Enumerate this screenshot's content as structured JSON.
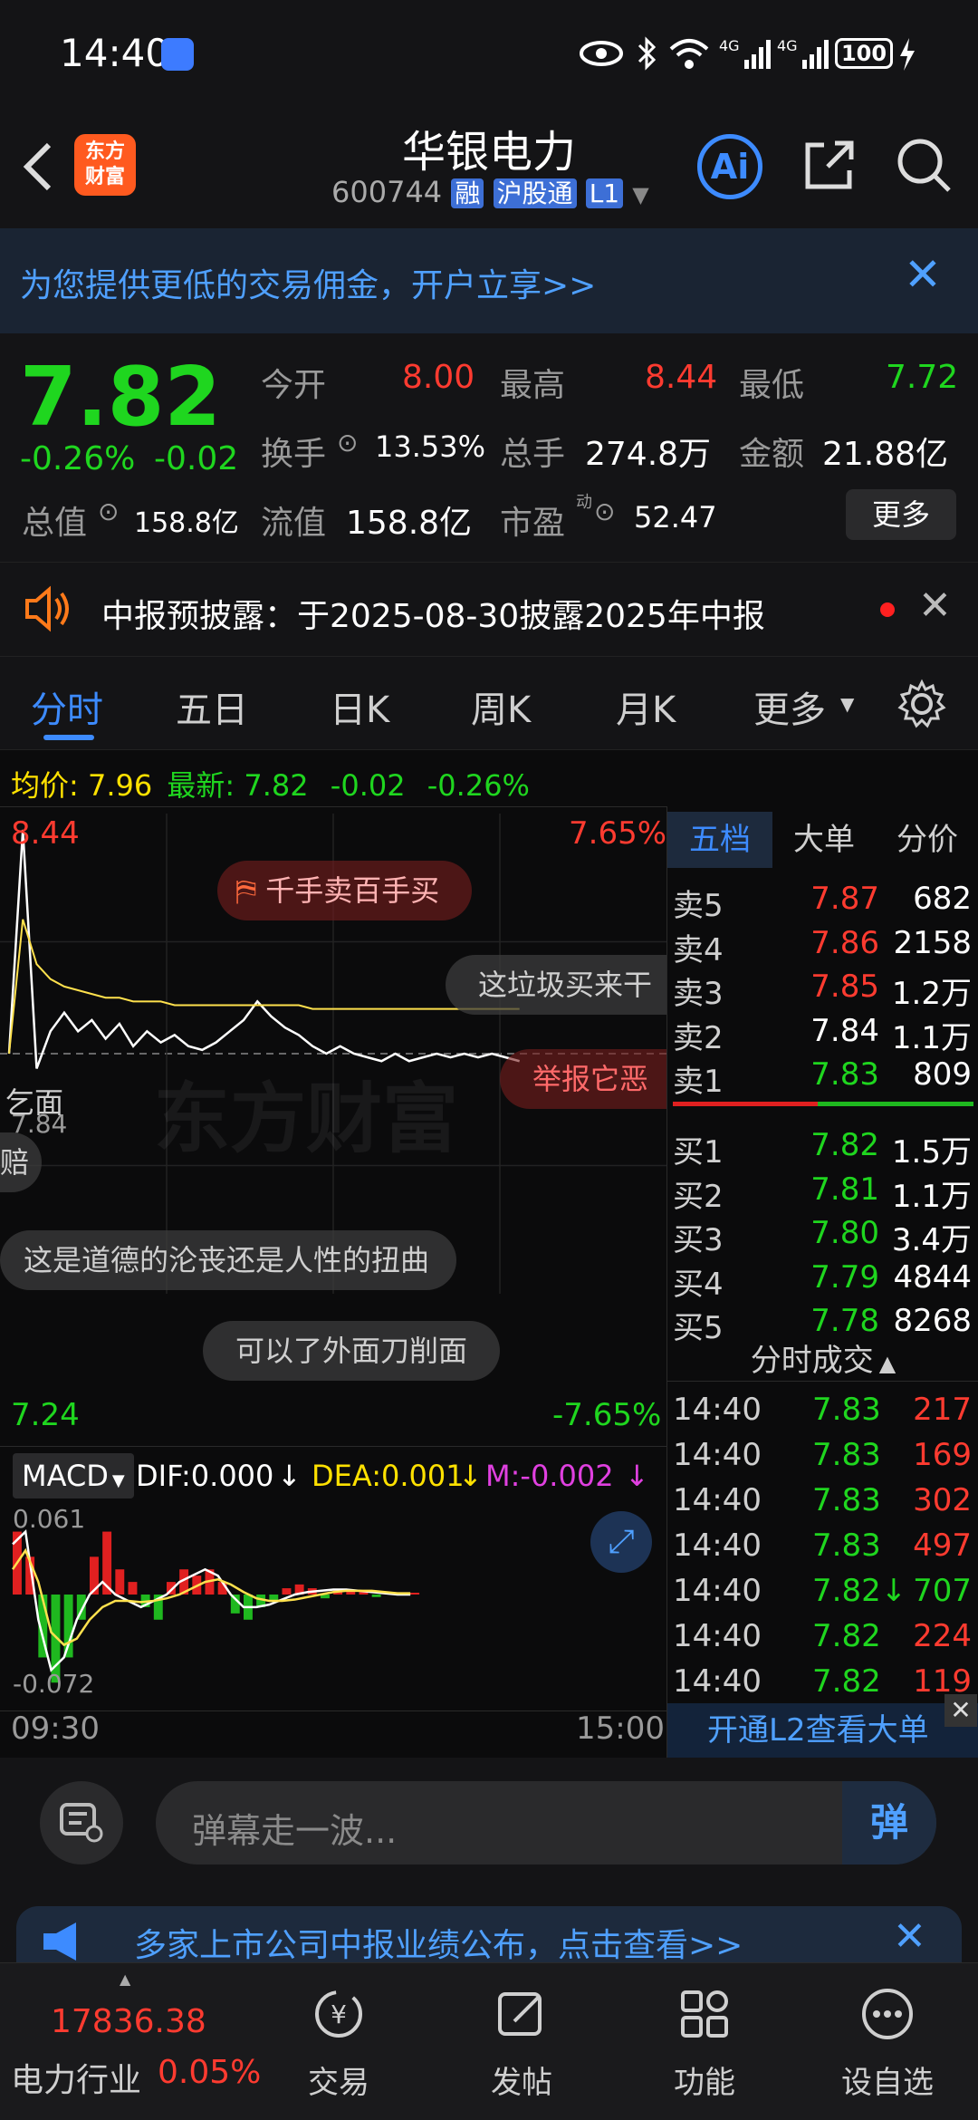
{
  "status_bar": {
    "time": "14:40",
    "battery": "100"
  },
  "nav": {
    "title": "华银电力",
    "code": "600744",
    "tag_rong": "融",
    "tag_hgt": "沪股通",
    "tag_level": "L1",
    "ai_label": "Ai"
  },
  "banner": {
    "text": "为您提供更低的交易佣金，开户立享>>"
  },
  "quote": {
    "price": "7.82",
    "change_pct": "-0.26%",
    "change": "-0.02",
    "open_label": "今开",
    "open": "8.00",
    "high_label": "最高",
    "high": "8.44",
    "low_label": "最低",
    "low": "7.72",
    "turnover_label": "换手",
    "turnover": "13.53%",
    "volume_label": "总手",
    "volume": "274.8万",
    "amount_label": "金额",
    "amount": "21.88亿",
    "mktcap_label": "总值",
    "mktcap": "158.8亿",
    "float_label": "流值",
    "float": "158.8亿",
    "pe_label": "市盈",
    "pe_sup": "动",
    "pe": "52.47",
    "more_label": "更多"
  },
  "notice": {
    "text": "中报预披露：于2025-08-30披露2025年中报"
  },
  "tabs": [
    "分时",
    "五日",
    "日K",
    "周K",
    "月K",
    "更多"
  ],
  "info_line": {
    "avg_label": "均价:",
    "avg": "7.96",
    "last_label": "最新:",
    "last": "7.82",
    "chg": "-0.02",
    "pct": "-0.26%"
  },
  "chart": {
    "max_price": "8.44",
    "max_pct": "7.65%",
    "min_price": "7.24",
    "min_pct": "-7.65%",
    "ref_price": "7.84",
    "watermark": "东方财富",
    "time_start": "09:30",
    "time_end": "15:00",
    "macd_label": "MACD",
    "dif": "DIF:0.000",
    "dea": "DEA:0.001",
    "m": "M:-0.002",
    "macd_max": "0.061",
    "macd_min": "-0.072"
  },
  "chart_data": {
    "type": "line",
    "series": [
      {
        "values": [
          7.84,
          8.44,
          7.8,
          7.9,
          7.95,
          7.9,
          7.93,
          7.88,
          7.92,
          7.86,
          7.9,
          7.87,
          7.89,
          7.86,
          7.85,
          7.87,
          7.9,
          7.93,
          7.98,
          7.94,
          7.91,
          7.89,
          7.86,
          7.84,
          7.86,
          7.84,
          7.83,
          7.82,
          7.84,
          7.82,
          7.83,
          7.84,
          7.83,
          7.84,
          7.83,
          7.84,
          7.83,
          7.82
        ]
      },
      {
        "values": [
          7.84,
          8.2,
          8.08,
          8.04,
          8.02,
          8.01,
          8.0,
          7.99,
          7.99,
          7.98,
          7.98,
          7.98,
          7.97,
          7.97,
          7.97,
          7.97,
          7.97,
          7.97,
          7.97,
          7.97,
          7.97,
          7.97,
          7.96,
          7.96,
          7.96,
          7.96,
          7.96,
          7.96,
          7.96,
          7.96,
          7.96,
          7.96,
          7.96,
          7.96,
          7.96,
          7.96,
          7.96,
          7.96
        ]
      }
    ],
    "ylim": [
      7.24,
      8.44
    ],
    "macd_bars": [
      0.05,
      0.03,
      -0.05,
      -0.07,
      -0.05,
      -0.02,
      0.03,
      0.05,
      0.02,
      0.01,
      -0.01,
      -0.02,
      0.01,
      0.02,
      0.015,
      0.02,
      0.01,
      -0.015,
      -0.02,
      -0.01,
      -0.005,
      0.005,
      0.008,
      0.005,
      -0.003,
      0.004,
      0.003,
      0.002,
      -0.002,
      0.002,
      0.001,
      0.0
    ]
  },
  "order_book": {
    "tabs": [
      "五档",
      "大单",
      "分价"
    ],
    "sell": [
      {
        "label": "卖5",
        "price": "7.87",
        "vol": "682"
      },
      {
        "label": "卖4",
        "price": "7.86",
        "vol": "2158"
      },
      {
        "label": "卖3",
        "price": "7.85",
        "vol": "1.2万"
      },
      {
        "label": "卖2",
        "price": "7.84",
        "vol": "1.1万"
      },
      {
        "label": "卖1",
        "price": "7.83",
        "vol": "809"
      }
    ],
    "buy": [
      {
        "label": "买1",
        "price": "7.82",
        "vol": "1.5万"
      },
      {
        "label": "买2",
        "price": "7.81",
        "vol": "1.1万"
      },
      {
        "label": "买3",
        "price": "7.80",
        "vol": "3.4万"
      },
      {
        "label": "买4",
        "price": "7.79",
        "vol": "4844"
      },
      {
        "label": "买5",
        "price": "7.78",
        "vol": "8268"
      }
    ],
    "ticks_title": "分时成交",
    "ticks": [
      {
        "time": "14:40",
        "price": "7.83",
        "vol": "217"
      },
      {
        "time": "14:40",
        "price": "7.83",
        "vol": "169"
      },
      {
        "time": "14:40",
        "price": "7.83",
        "vol": "302"
      },
      {
        "time": "14:40",
        "price": "7.83",
        "vol": "497"
      },
      {
        "time": "14:40",
        "price": "7.82↓",
        "vol": "707"
      },
      {
        "time": "14:40",
        "price": "7.82",
        "vol": "224"
      },
      {
        "time": "14:40",
        "price": "7.82",
        "vol": "119"
      }
    ],
    "l2_label": "开通L2查看大单"
  },
  "danmu": {
    "d1": "千手卖百手买",
    "d2": "这垃圾买来干",
    "d3": "乞面",
    "d4": "举报它恶",
    "d5": "赔",
    "d6": "这是道德的沦丧还是人性的扭曲",
    "d7": "可以了外面刀削面"
  },
  "input": {
    "placeholder": "弹幕走一波...",
    "send_label": "弹"
  },
  "ad2": {
    "text": "多家上市公司中报业绩公布，点击查看>>"
  },
  "bottom": {
    "index_value": "17836.38",
    "index_name": "电力行业",
    "index_pct": "0.05%",
    "trade": "交易",
    "post": "发帖",
    "func": "功能",
    "watch": "设自选"
  }
}
